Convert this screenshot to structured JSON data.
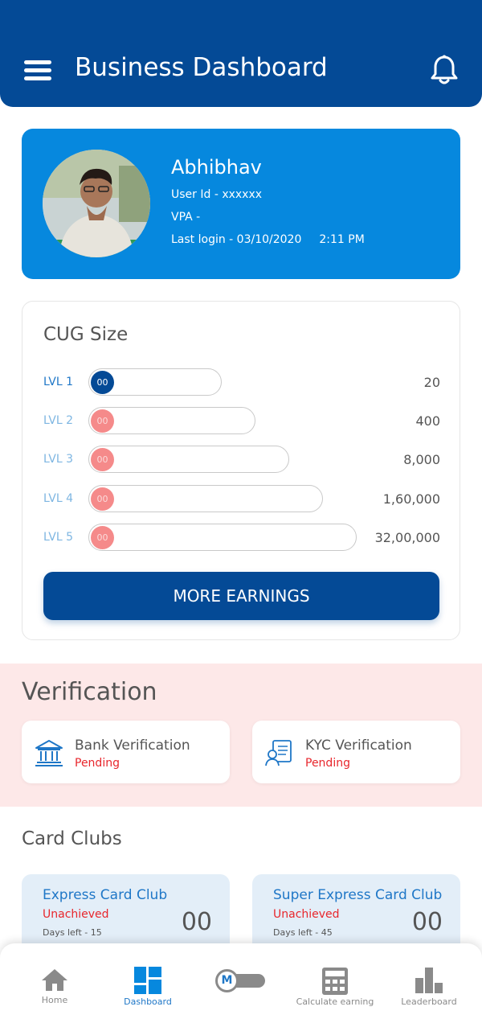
{
  "header": {
    "title": "Business Dashboard"
  },
  "profile": {
    "name": "Abhibhav",
    "user_id": "User Id - xxxxxx",
    "vpa": "VPA -",
    "last_login": "Last login - 03/10/2020",
    "last_login_time": "2:11 PM"
  },
  "cug": {
    "title": "CUG Size",
    "levels": [
      {
        "label": "LVL 1",
        "count": "00",
        "value": "20"
      },
      {
        "label": "LVL 2",
        "count": "00",
        "value": "400"
      },
      {
        "label": "LVL 3",
        "count": "00",
        "value": "8,000"
      },
      {
        "label": "LVL 4",
        "count": "00",
        "value": "1,60,000"
      },
      {
        "label": "LVL 5",
        "count": "00",
        "value": "32,00,000"
      }
    ],
    "button_label": "MORE EARNINGS"
  },
  "verification": {
    "title": "Verification",
    "bank": {
      "name": "Bank Verification",
      "status": "Pending"
    },
    "kyc": {
      "name": "KYC Verification",
      "status": "Pending"
    }
  },
  "clubs": {
    "title": "Card Clubs",
    "items": [
      {
        "name": "Express Card Club",
        "status": "Unachieved",
        "days": "Days left - 15",
        "count": "00"
      },
      {
        "name": "Super Express Card Club",
        "status": "Unachieved",
        "days": "Days left - 45",
        "count": "00"
      }
    ]
  },
  "nav": {
    "home": "Home",
    "dashboard": "Dashboard",
    "toggle_letter": "M",
    "calculate": "Calculate earning",
    "leaderboard": "Leaderboard"
  },
  "colors": {
    "primary": "#044a96",
    "accent": "#0688de",
    "pending": "#e8262c",
    "level_dot_inactive": "#f58a8a",
    "verification_bg": "#fde8e8",
    "club_bg": "#e3eef8"
  }
}
